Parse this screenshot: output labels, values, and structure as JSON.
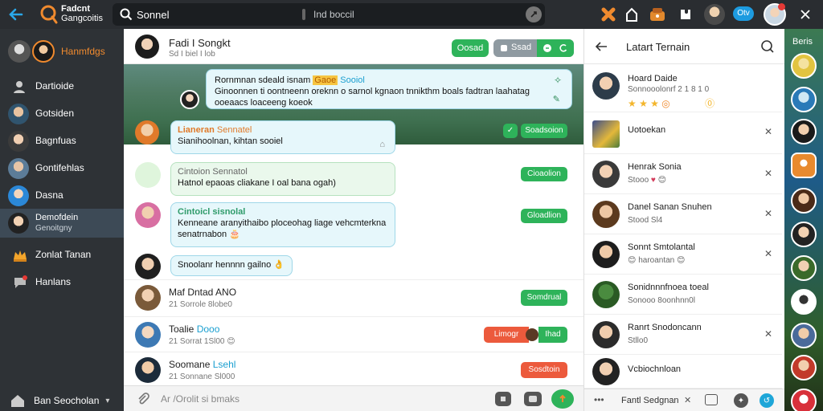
{
  "topbar": {
    "app_title_line1": "Fadcnt",
    "app_title_line2": "Gangcoitis",
    "search_value": "Sonnel",
    "search_hint": "Ind boccil",
    "status_label": "Otv"
  },
  "sidebar": {
    "profile_label": "Hanmfdgs",
    "items": [
      {
        "label": "Dartioide"
      },
      {
        "label": "Gotsiden"
      },
      {
        "label": "Bagnfuas"
      },
      {
        "label": "Gontifehlas"
      },
      {
        "label": "Dasna"
      },
      {
        "label_line1": "Demofdein",
        "label_line2": "Genoitgny"
      },
      {
        "label": "Zonlat Tanan"
      },
      {
        "label": "Hanlans"
      }
    ],
    "footer_label": "Ban Seocholan"
  },
  "chat": {
    "header": {
      "name": "Fadi I Songkt",
      "status": "Sd I biel I lob",
      "btn_online": "Oosad",
      "btn_ssad": "Ssad"
    },
    "banner": {
      "title_prefix": "Rornmnan sdeald isnam",
      "title_highlight": "Gaoe",
      "title_suffix": "Sooiol",
      "line2": "Ginoonnen ti oontneenn oreknn o sarnol kgnaon tnnikthm boals fadtran laahatag",
      "line3": "ooeaacs loaceeng koeok"
    },
    "bubbles": [
      {
        "name": "Lianeran",
        "name2": "Sennatel",
        "text": "Sianihoolnan, kihtan sooiel"
      },
      {
        "name": "Cintoion",
        "name2": "Sennatol",
        "text": "Hatnol epaoas cliakane I oal bana ogah)"
      },
      {
        "name": "Cintoicl",
        "name2": "sisnolal",
        "text": "Kenneane aranyithaibo ploceohag liage vehcmterkna",
        "text2": "senatrnabon"
      },
      {
        "text": "Snoolanr hennnn gailno"
      }
    ],
    "tags": {
      "t1": "Soadsoion",
      "t2": "Cioaolion",
      "t3": "Gloadlion"
    },
    "rows": [
      {
        "name": "Maf Dntad ANO",
        "sub": "21 Sorrole 8lobe0",
        "btn": "Somdrual"
      },
      {
        "name": "Toalie",
        "name_hl": "Dooo",
        "sub": "21 Sorrat 1Sl00",
        "btn_a": "Limogr",
        "btn_b": "Ihad"
      },
      {
        "name": "Soomane",
        "name_hl": "Lsehl",
        "sub": "21 Sonnane Sl000",
        "btn": "Sosdtoin"
      }
    ]
  },
  "inputbar": {
    "placeholder": "Ar /Orolit si bmaks"
  },
  "rpanel": {
    "title": "Latart Ternain",
    "items": [
      {
        "t1": "Hoard Daide",
        "t2": "Sonnooolonrf 2 1 8 1 0"
      },
      {
        "t1": "Uotoekan",
        "t2": ""
      },
      {
        "t1": "Henrak Sonia",
        "t2": "Stooo"
      },
      {
        "t1": "Danel Sanan Snuhen",
        "t2": "Stood Sl4"
      },
      {
        "t1": "Sonnt Smtolantal",
        "t2": "haroantan",
        "hl": "Sonnt"
      },
      {
        "t1": "Sonidnnnfnoea toeal",
        "t2": "Sonooo 8oonhnn0l"
      },
      {
        "t1": "Ranrt Snodoncann",
        "t2": "Stllo0"
      },
      {
        "t1": "Vcbiochnloan",
        "t2": ""
      }
    ],
    "footer_label": "Fantl Sedgnan"
  },
  "strip": {
    "label": "Beris"
  },
  "colors": {
    "accent_green": "#2eb35a",
    "accent_red": "#ec5a3c",
    "bubble_bg": "#e6f7fb",
    "dark_bg": "#2a2d31"
  }
}
